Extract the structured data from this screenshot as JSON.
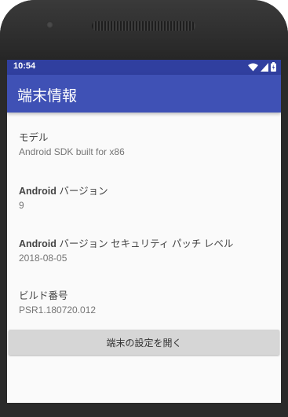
{
  "status_bar": {
    "time": "10:54",
    "icons": [
      "wifi-icon",
      "signal-icon",
      "battery-icon"
    ]
  },
  "app_bar": {
    "title": "端末情報",
    "color": "#3f51b5",
    "status_color": "#303f9f"
  },
  "info_items": [
    {
      "label": "モデル",
      "value": "Android SDK built for x86"
    },
    {
      "label_bold": "Android",
      "label": " バージョン",
      "value": "9"
    },
    {
      "label_bold": "Android",
      "label": " バージョン セキュリティ パッチ レベル",
      "value": "2018-08-05"
    },
    {
      "label": "ビルド番号",
      "value": "PSR1.180720.012"
    }
  ],
  "settings_button": {
    "label": "端末の設定を開く"
  }
}
